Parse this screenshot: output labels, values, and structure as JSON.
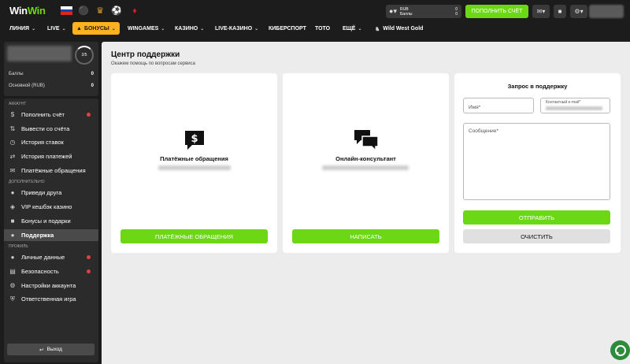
{
  "header": {
    "logo_part1": "Win",
    "logo_part2": "Win",
    "currency": "RUB",
    "currency_value": "0",
    "points_label": "Баллы",
    "points_value": "0",
    "deposit_button": "ПОПОЛНИТЬ СЧЁТ"
  },
  "nav": {
    "items": [
      {
        "label": "ЛИНИЯ"
      },
      {
        "label": "LIVE"
      },
      {
        "label": "БОНУСЫ"
      },
      {
        "label": "WINGAMES"
      },
      {
        "label": "КАЗИНО"
      },
      {
        "label": "LIVE-КАЗИНО"
      },
      {
        "label": "КИБЕРСПОРТ"
      },
      {
        "label": "ТОТО"
      },
      {
        "label": "ЕЩЁ"
      },
      {
        "label": "Wild West Gold"
      }
    ]
  },
  "profile": {
    "level": "2/5",
    "points_label": "Баллы",
    "points_value": "0",
    "main_label": "Основной (RUB)",
    "main_value": "0"
  },
  "sidebar": {
    "section_account": "Аккаунт",
    "section_extra": "Дополнительно",
    "section_profile": "Профиль",
    "items": [
      {
        "label": "Пополнить счёт",
        "icon": "dollar-icon"
      },
      {
        "label": "Вывести со счёта",
        "icon": "withdraw-icon"
      },
      {
        "label": "История ставок",
        "icon": "history-icon"
      },
      {
        "label": "История платежей",
        "icon": "payments-history-icon"
      },
      {
        "label": "Платёжные обращения",
        "icon": "payment-requests-icon"
      },
      {
        "label": "Приведи друга",
        "icon": "invite-friend-icon"
      },
      {
        "label": "VIP кешбэк казино",
        "icon": "vip-icon"
      },
      {
        "label": "Бонусы и подарки",
        "icon": "gift-icon"
      },
      {
        "label": "Поддержка",
        "icon": "support-icon"
      },
      {
        "label": "Личные данные",
        "icon": "user-icon"
      },
      {
        "label": "Безопасность",
        "icon": "lock-icon"
      },
      {
        "label": "Настройки аккаунта",
        "icon": "gear-icon"
      },
      {
        "label": "Ответственная игра",
        "icon": "shield-icon"
      }
    ],
    "logout": "Выход"
  },
  "main": {
    "title": "Центр поддержки",
    "subtitle": "Окажем помощь по вопросам сервиса",
    "cards": [
      {
        "title": "Платёжные обращения",
        "button": "ПЛАТЁЖНЫЕ ОБРАЩЕНИЯ"
      },
      {
        "title": "Онлайн-консультант",
        "button": "НАПИСАТЬ"
      }
    ],
    "form": {
      "title": "Запрос в поддержку",
      "name_placeholder": "Имя*",
      "email_label": "Контактный e-mail*",
      "message_placeholder": "Сообщение*",
      "submit": "ОТПРАВИТЬ",
      "clear": "ОЧИСТИТЬ"
    }
  },
  "colors": {
    "accent_green": "#6cd815",
    "bonus_orange": "#ffb21e"
  }
}
